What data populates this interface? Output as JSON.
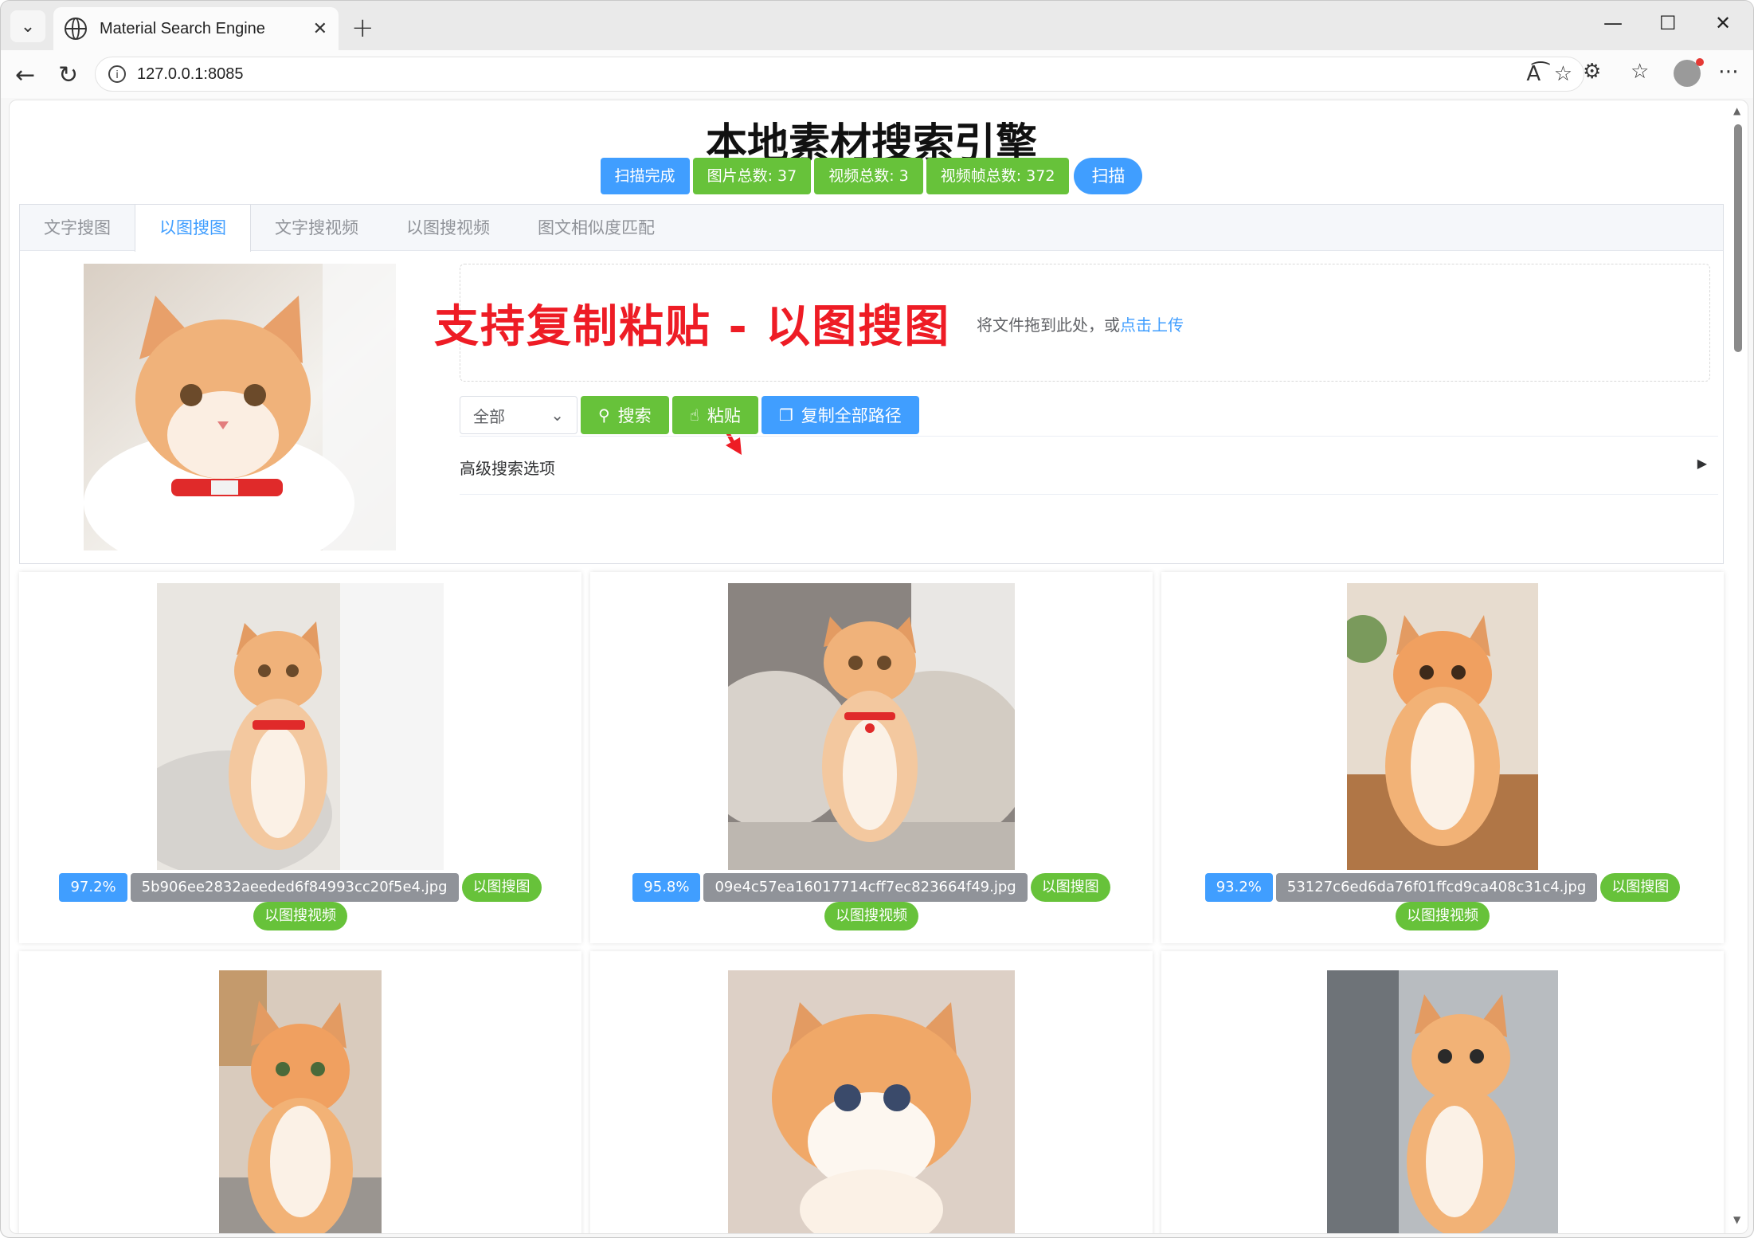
{
  "browser": {
    "tab_title": "Material Search Engine",
    "url": "127.0.0.1:8085"
  },
  "header": {
    "title": "本地素材搜索引擎",
    "stats": [
      {
        "label": "扫描完成",
        "color": "#409eff"
      },
      {
        "label": "图片总数: 37",
        "color": "#67c23a"
      },
      {
        "label": "视频总数: 3",
        "color": "#67c23a"
      },
      {
        "label": "视频帧总数: 372",
        "color": "#67c23a"
      }
    ],
    "scan_button": "扫描"
  },
  "tabs": [
    {
      "label": "文字搜图",
      "active": false
    },
    {
      "label": "以图搜图",
      "active": true
    },
    {
      "label": "文字搜视频",
      "active": false
    },
    {
      "label": "以图搜视频",
      "active": false
    },
    {
      "label": "图文相似度匹配",
      "active": false
    }
  ],
  "upload": {
    "hint_prefix": "将文件拖到此处，或",
    "hint_link": "点击上传"
  },
  "promo_text": "支持复制粘贴 - 以图搜图",
  "controls": {
    "select_value": "全部",
    "search_label": "搜索",
    "paste_label": "粘贴",
    "copy_all_label": "复制全部路径"
  },
  "advanced_label": "高级搜索选项",
  "results": [
    {
      "score": "97.2%",
      "filename": "5b906ee2832aeeded6f84993cc20f5e4.jpg",
      "img_search": "以图搜图",
      "video_search": "以图搜视频"
    },
    {
      "score": "95.8%",
      "filename": "09e4c57ea16017714cff7ec823664f49.jpg",
      "img_search": "以图搜图",
      "video_search": "以图搜视频"
    },
    {
      "score": "93.2%",
      "filename": "53127c6ed6da76f01ffcd9ca408c31c4.jpg",
      "img_search": "以图搜图",
      "video_search": "以图搜视频"
    }
  ],
  "colors": {
    "primary": "#409eff",
    "success": "#67c23a",
    "info": "#909399",
    "promo_red": "#ee1c25"
  }
}
